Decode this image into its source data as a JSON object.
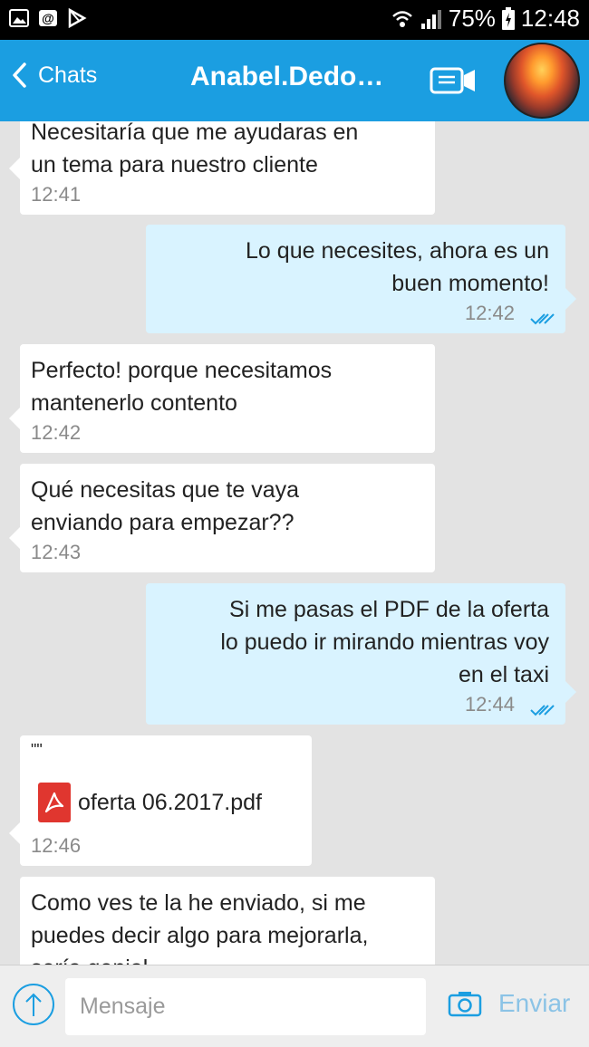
{
  "status_bar": {
    "battery": "75%",
    "time": "12:48",
    "icons": [
      "gallery-icon",
      "email-icon",
      "play-store-icon",
      "wifi-icon",
      "signal-icon",
      "battery-icon"
    ]
  },
  "header": {
    "back_label": "Chats",
    "contact_name": "Anabel.Dedom…",
    "icons": [
      "chevron-left-icon",
      "video-call-icon",
      "contact-avatar"
    ]
  },
  "messages": [
    {
      "direction": "incoming",
      "lines": [
        "Necesitaría que me ayudaras en",
        "un tema para nuestro cliente"
      ],
      "time": "12:41"
    },
    {
      "direction": "outgoing",
      "lines": [
        "Lo que necesites, ahora es un",
        "buen momento!"
      ],
      "time": "12:42",
      "status": "read"
    },
    {
      "direction": "incoming",
      "lines": [
        "Perfecto! porque necesitamos",
        "mantenerlo contento"
      ],
      "time": "12:42"
    },
    {
      "direction": "incoming",
      "lines": [
        "Qué necesitas que te vaya",
        "enviando para empezar??"
      ],
      "time": "12:43"
    },
    {
      "direction": "outgoing",
      "lines": [
        "Si me pasas el PDF de la oferta",
        "lo puedo ir mirando mientras voy",
        "en el taxi"
      ],
      "time": "12:44",
      "status": "read"
    },
    {
      "direction": "incoming",
      "type": "file",
      "caption": "\"\"",
      "filename": "oferta 06.2017.pdf",
      "time": "12:46"
    },
    {
      "direction": "incoming",
      "lines": [
        "Como ves te la he enviado, si me",
        "puedes decir algo para mejorarla,",
        "sería genial"
      ]
    }
  ],
  "composer": {
    "placeholder": "Mensaje",
    "send_label": "Enviar"
  },
  "colors": {
    "header": "#1b9ee1",
    "outgoing_bubble": "#d9f3ff",
    "incoming_bubble": "#ffffff",
    "background": "#e3e3e3",
    "read_ticks": "#1b9ee1",
    "pdf_icon": "#e0362f"
  }
}
